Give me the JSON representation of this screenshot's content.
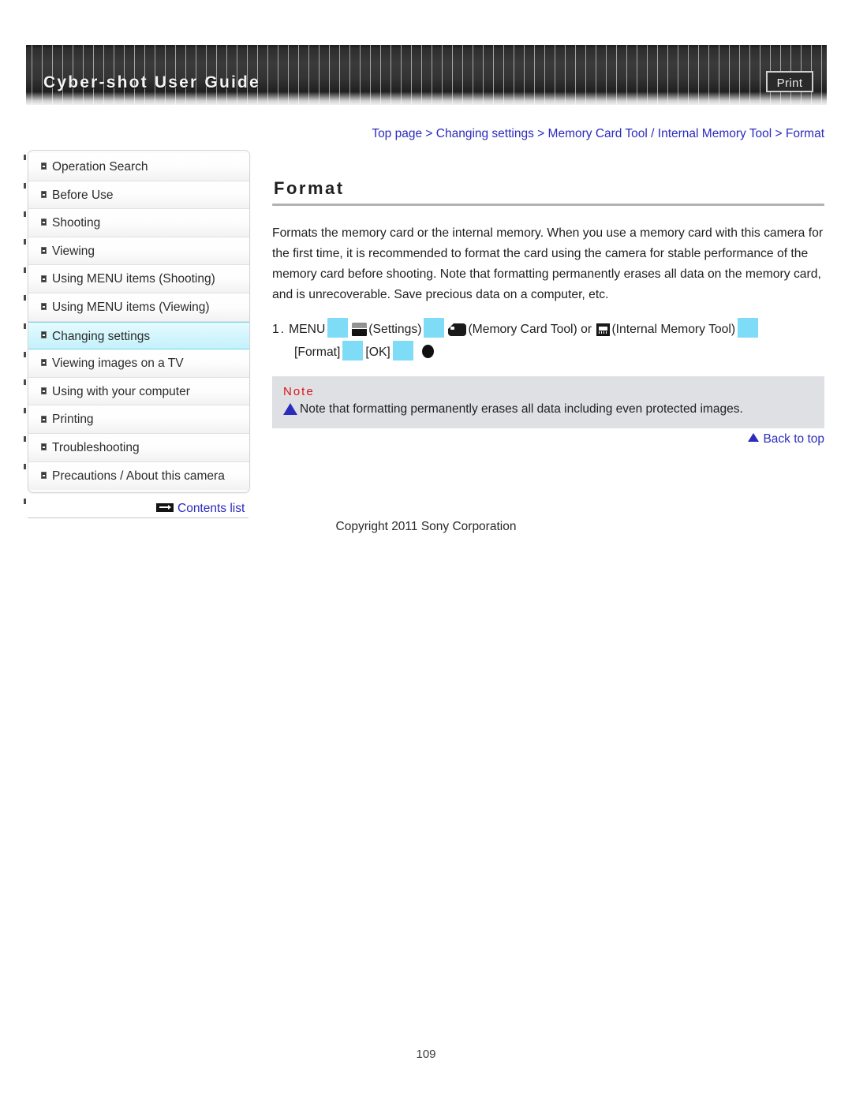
{
  "header": {
    "title": "Cyber-shot User Guide",
    "print_label": "Print"
  },
  "breadcrumb": {
    "separator": " > ",
    "items": [
      "Top page",
      "Changing settings",
      "Memory Card Tool / Internal Memory Tool",
      "Format"
    ],
    "full_text": "Top page > Changing settings > Memory Card Tool / Internal Memory Tool > Format"
  },
  "sidebar": {
    "items": [
      {
        "label": "Operation Search",
        "active": false
      },
      {
        "label": "Before Use",
        "active": false
      },
      {
        "label": "Shooting",
        "active": false
      },
      {
        "label": "Viewing",
        "active": false
      },
      {
        "label": "Using MENU items (Shooting)",
        "active": false
      },
      {
        "label": "Using MENU items (Viewing)",
        "active": false
      },
      {
        "label": "Changing settings",
        "active": true
      },
      {
        "label": "Viewing images on a TV",
        "active": false
      },
      {
        "label": "Using with your computer",
        "active": false
      },
      {
        "label": "Printing",
        "active": false
      },
      {
        "label": "Troubleshooting",
        "active": false
      },
      {
        "label": "Precautions / About this camera",
        "active": false
      }
    ],
    "contents_list_label": "Contents list"
  },
  "main": {
    "title": "Format",
    "paragraph": "Formats the memory card or the internal memory. When you use a memory card with this camera for the first time, it is recommended to format the card using the camera for stable performance of the memory card before shooting. Note that formatting permanently erases all data on the memory card, and is unrecoverable. Save precious data on a computer, etc.",
    "step": {
      "number": "1.",
      "menu_label": "MENU",
      "settings_label": "(Settings)",
      "memory_card_tool_label": "(Memory Card Tool)",
      "or_label": "or",
      "internal_memory_tool_label": "(Internal Memory Tool)",
      "format_label": "[Format]",
      "ok_label": "[OK]"
    },
    "note": {
      "label": "Note",
      "text": "Note that formatting permanently erases all data including even protected images."
    },
    "back_to_top_label": "Back to top"
  },
  "footer": {
    "copyright": "Copyright 2011 Sony Corporation",
    "page_number": "109"
  },
  "colors": {
    "link_blue": "#2b2bbd",
    "note_red": "#d81616",
    "placeholder_cyan": "#7fdcf7",
    "active_nav_cyan": "#c6f1fb",
    "note_box_gray": "#dfe0e4"
  }
}
